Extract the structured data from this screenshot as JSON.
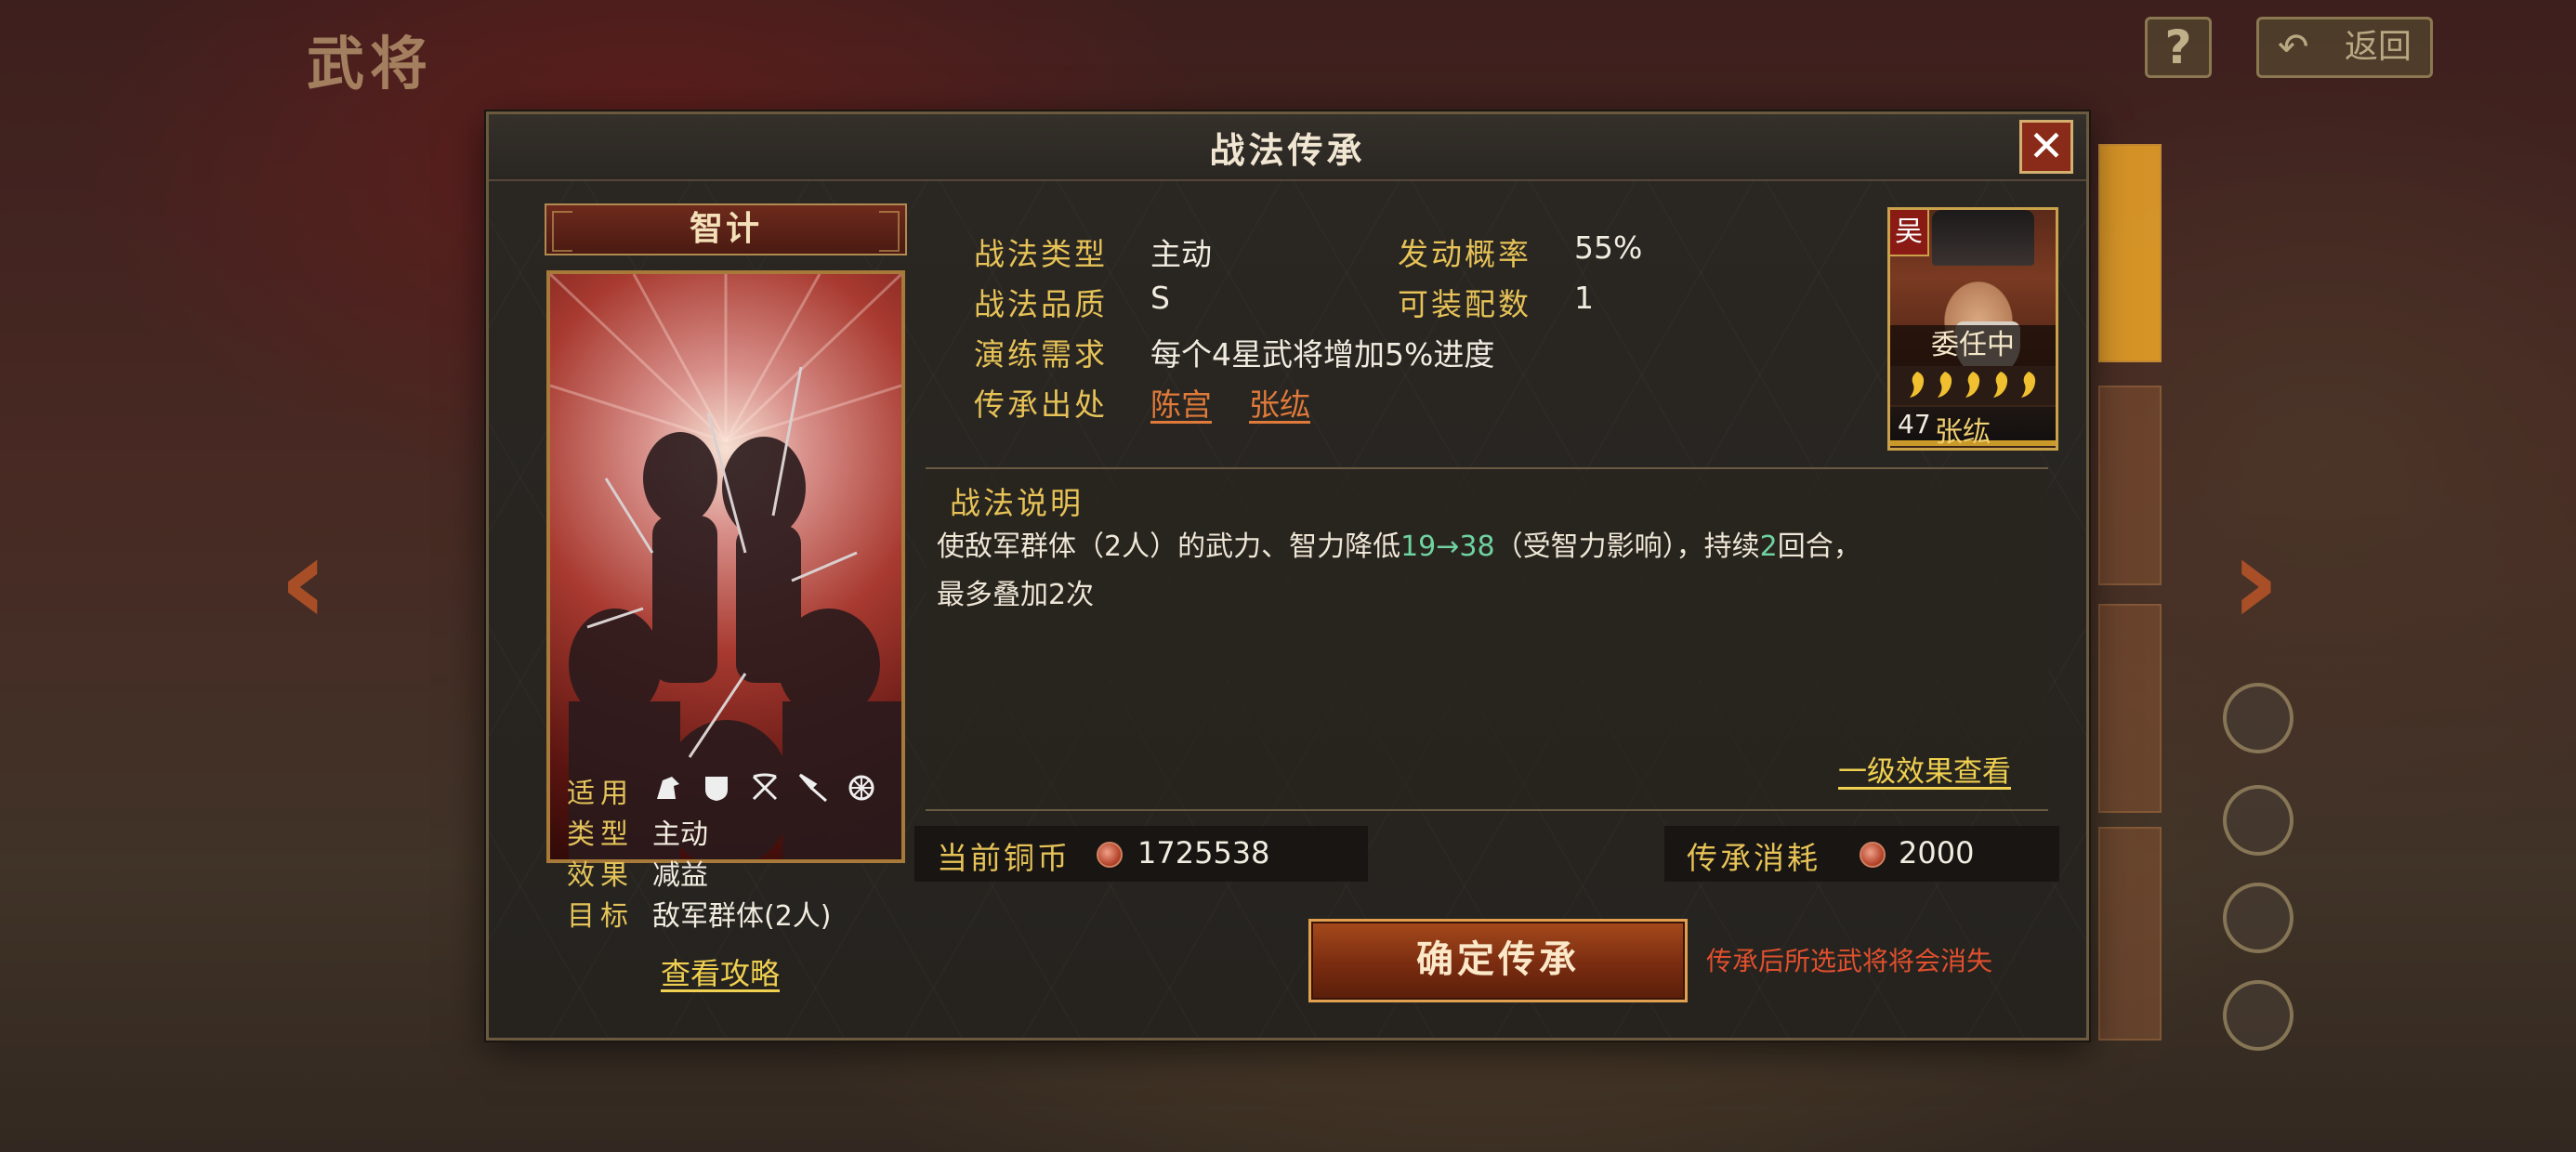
{
  "background": {
    "page_title": "武将",
    "help_label": "?",
    "back_label": "返回"
  },
  "dialog": {
    "title": "战法传承",
    "close_glyph": "✕"
  },
  "skill": {
    "name": "智计",
    "info": [
      {
        "label": "适用",
        "value": ""
      },
      {
        "label": "类型",
        "value": "主动"
      },
      {
        "label": "效果",
        "value": "减益"
      },
      {
        "label": "目标",
        "value": "敌军群体(2人)"
      }
    ],
    "troop_icons": [
      "cavalry-icon",
      "shield-icon",
      "bow-icon",
      "spear-icon",
      "wheel-icon"
    ],
    "guide_link": "查看攻略"
  },
  "attributes": {
    "type_label": "战法类型",
    "type_value": "主动",
    "rate_label": "发动概率",
    "rate_value": "55%",
    "quality_label": "战法品质",
    "quality_value": "S",
    "slots_label": "可装配数",
    "slots_value": "1",
    "drill_label": "演练需求",
    "drill_value": "每个4星武将增加5%进度",
    "source_label": "传承出处",
    "source_1": "陈宫",
    "source_2": "张纮"
  },
  "general": {
    "faction": "吴",
    "status": "委任中",
    "stars": 5,
    "level": "47",
    "name": "张纮"
  },
  "description": {
    "title": "战法说明",
    "part1": "使敌军群体（2人）的武力、智力降低",
    "range_from": "19",
    "range_arrow": "→",
    "range_to": "38",
    "part2": "（受智力影响），持续",
    "turns": "2",
    "part3": "回合，",
    "line2": "最多叠加2次",
    "level_link": "一级效果查看"
  },
  "coins": {
    "current_label": "当前铜币",
    "current_value": "1725538",
    "cost_label": "传承消耗",
    "cost_value": "2000"
  },
  "confirm_button": "确定传承",
  "warning": "传承后所选武将将会消失",
  "colors": {
    "gold_label": "#e6c257",
    "link_orange": "#e07a3a",
    "highlight_green": "#6fd2a0",
    "warning_red": "#e0502e"
  }
}
